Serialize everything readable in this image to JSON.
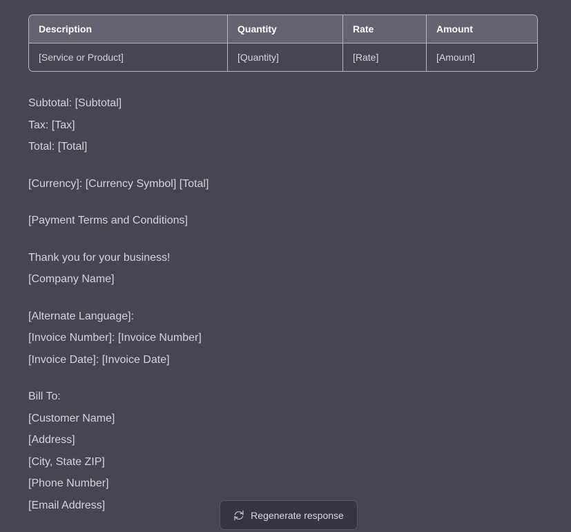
{
  "theme": {
    "page_background": "#444654",
    "table_header_background": "#636471",
    "table_border": "#b3b6c2",
    "text_color": "#d1d5db",
    "header_text_color": "#ffffff",
    "button_background": "#343541",
    "button_border": "#55566a",
    "button_text_color": "#d9d9e3"
  },
  "table": {
    "columns": [
      "Description",
      "Quantity",
      "Rate",
      "Amount"
    ],
    "rows": [
      [
        "[Service or Product]",
        "[Quantity]",
        "[Rate]",
        "[Amount]"
      ]
    ]
  },
  "body": {
    "paragraphs": [
      {
        "lines": [
          "Subtotal: [Subtotal]",
          "Tax: [Tax]",
          "Total: [Total]"
        ]
      },
      {
        "lines": [
          "[Currency]: [Currency Symbol] [Total]"
        ]
      },
      {
        "lines": [
          "[Payment Terms and Conditions]"
        ]
      },
      {
        "lines": [
          "Thank you for your business!",
          "[Company Name]"
        ]
      },
      {
        "lines": [
          "[Alternate Language]:",
          "[Invoice Number]: [Invoice Number]",
          "[Invoice Date]: [Invoice Date]"
        ]
      },
      {
        "lines": [
          "Bill To:",
          "[Customer Name]",
          "[Address]",
          "[City, State ZIP]",
          "[Phone Number]",
          "[Email Address]"
        ]
      }
    ]
  },
  "regenerate_button": {
    "label": "Regenerate response",
    "icon": "refresh-icon"
  }
}
